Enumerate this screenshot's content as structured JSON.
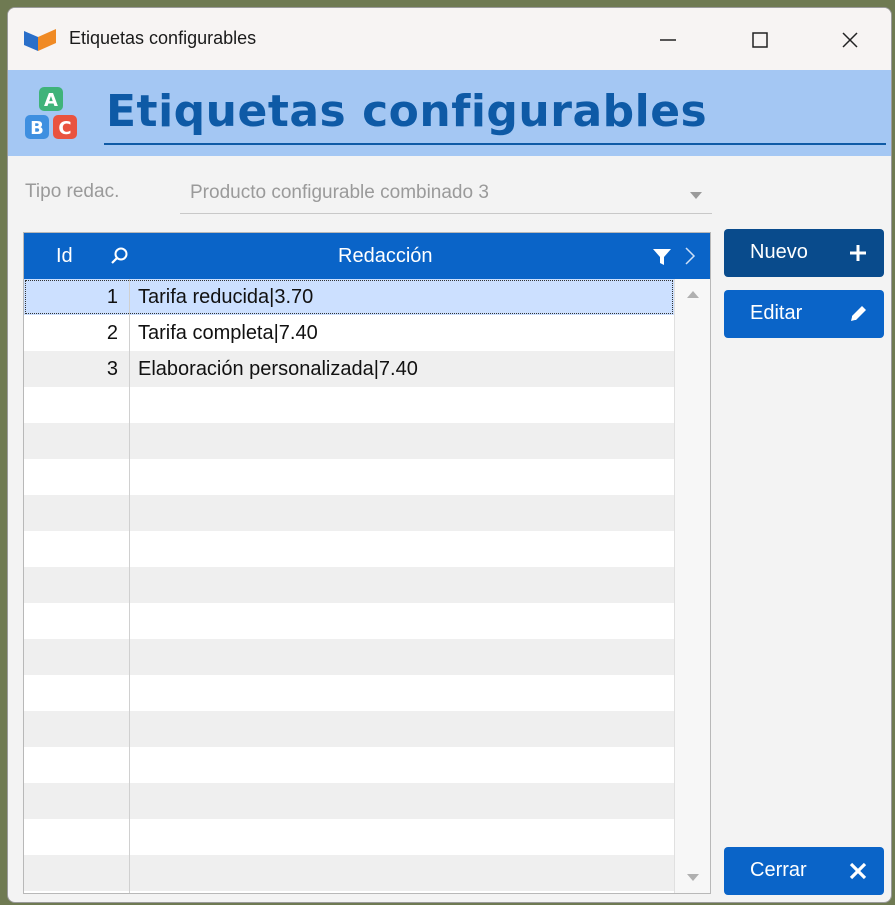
{
  "window": {
    "title": "Etiquetas configurables"
  },
  "header": {
    "title": "Etiquetas configurables"
  },
  "tipo": {
    "label": "Tipo redac.",
    "value": "Producto configurable combinado 3"
  },
  "grid": {
    "columns": {
      "id": "Id",
      "redaccion": "Redacción"
    },
    "rows": [
      {
        "id": "1",
        "redaccion": "Tarifa reducida|3.70"
      },
      {
        "id": "2",
        "redaccion": "Tarifa completa|7.40"
      },
      {
        "id": "3",
        "redaccion": "Elaboración personalizada|7.40"
      }
    ],
    "empty_rows": 14
  },
  "buttons": {
    "nuevo": "Nuevo",
    "editar": "Editar",
    "cerrar": "Cerrar"
  },
  "colors": {
    "accent": "#0a64c8",
    "header_bg": "#a4c7f3",
    "title": "#0e5aa6",
    "selected": "#cce0ff"
  },
  "icons": {
    "app": "app-logo-icon",
    "header": "abc-blocks-icon"
  }
}
